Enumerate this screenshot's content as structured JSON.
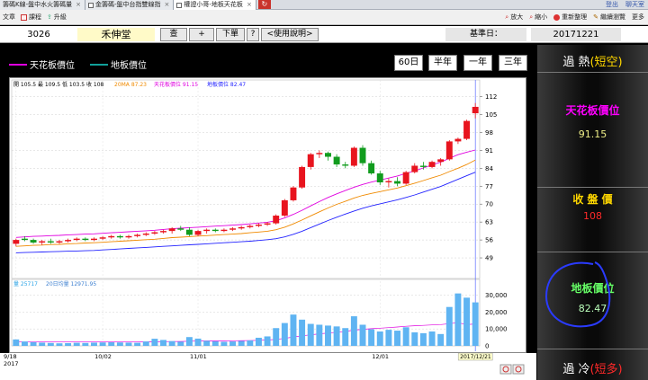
{
  "browser": {
    "tabs": [
      {
        "label": "籌碼K線-盤中水火籌碼量",
        "active": false
      },
      {
        "label": "金籌碼-盤中台指雙線指",
        "active": false
      },
      {
        "label": "權證小哥-地板天花板",
        "active": true
      }
    ],
    "right_links": [
      "登出",
      "聊天室"
    ]
  },
  "toolbar": {
    "left": [
      "文章",
      "課程",
      "升級"
    ],
    "right": [
      "放大",
      "縮小",
      "重新整理",
      "繼續瀏覽",
      "更多"
    ]
  },
  "app": {
    "stock_code": "3026",
    "stock_name": "禾伸堂",
    "buttons": {
      "query": "查",
      "add": "+",
      "next": "下單",
      "help_q": "?",
      "usage": "<使用說明>"
    },
    "base_date_label": "基準日：",
    "base_date": "20171221"
  },
  "legend": {
    "ceiling": "天花板價位",
    "floor": "地板價位"
  },
  "ranges": [
    "60日",
    "半年",
    "一年",
    "三年"
  ],
  "chart_info": {
    "ohlc": "開 105.5 最 109.5 低 103.5 收 108",
    "ma20": "20MA 87.23",
    "ceiling": "天花板價位 91.15",
    "floor": "地板價位 82.47",
    "volume": "量 25717",
    "vol_ma": "20日均量 12971.95",
    "current_date": "2017/12/21"
  },
  "right_panel": {
    "overheat_label": "過 熱",
    "overheat_suffix": "(短空)",
    "ceiling_label": "天花板價位",
    "ceiling_value": "91.15",
    "close_label": "收 盤 價",
    "close_value": "108",
    "floor_label": "地板價位",
    "floor_value": "82.47",
    "overcold_label": "過 冷",
    "overcold_suffix": "(短多)"
  },
  "colors": {
    "up": "#e8141e",
    "down": "#119c1e",
    "ceiling": "#e000e0",
    "floor": "#2222ff",
    "ma": "#f08a00",
    "volume": "#5fb4f2",
    "panel_yellow": "#ffd700",
    "panel_magenta": "#ff00ff",
    "panel_green": "#66ff66",
    "panel_red": "#ff2a2a"
  },
  "chart_data": {
    "type": "candlestick",
    "price_ylim": [
      42,
      115
    ],
    "price_ticks": [
      49,
      56,
      63,
      70,
      77,
      84,
      91,
      98,
      105,
      112
    ],
    "volume_ylim": [
      0,
      34000
    ],
    "volume_ticks": [
      "0",
      "10,000",
      "20,000",
      "30,000"
    ],
    "x_tick_labels": [
      {
        "label": "9/18",
        "index": 0
      },
      {
        "label": "10/02",
        "index": 10
      },
      {
        "label": "11/01",
        "index": 21
      },
      {
        "label": "12/01",
        "index": 42
      }
    ],
    "x_year_label": "2017",
    "candles": [
      {
        "o": 54.5,
        "h": 56.5,
        "l": 53.5,
        "c": 56,
        "v": 3800
      },
      {
        "o": 56.5,
        "h": 57.5,
        "l": 55.5,
        "c": 56,
        "v": 2600
      },
      {
        "o": 56,
        "h": 56.5,
        "l": 54.5,
        "c": 55,
        "v": 2200
      },
      {
        "o": 55,
        "h": 56,
        "l": 54,
        "c": 55.5,
        "v": 1900
      },
      {
        "o": 55.5,
        "h": 56.5,
        "l": 54.5,
        "c": 55,
        "v": 1700
      },
      {
        "o": 55,
        "h": 56,
        "l": 54.5,
        "c": 55.5,
        "v": 1500
      },
      {
        "o": 55.5,
        "h": 56.5,
        "l": 55,
        "c": 56,
        "v": 1600
      },
      {
        "o": 56,
        "h": 57,
        "l": 55.5,
        "c": 56.5,
        "v": 1800
      },
      {
        "o": 56.5,
        "h": 57,
        "l": 55.5,
        "c": 56,
        "v": 1700
      },
      {
        "o": 56,
        "h": 57,
        "l": 55.5,
        "c": 56.5,
        "v": 1900
      },
      {
        "o": 56.5,
        "h": 57.5,
        "l": 56,
        "c": 57,
        "v": 2000
      },
      {
        "o": 57,
        "h": 58,
        "l": 56.5,
        "c": 57.5,
        "v": 2100
      },
      {
        "o": 57.5,
        "h": 58,
        "l": 56.5,
        "c": 57,
        "v": 2000
      },
      {
        "o": 57,
        "h": 58,
        "l": 56.5,
        "c": 57.5,
        "v": 1900
      },
      {
        "o": 57.5,
        "h": 58.5,
        "l": 57,
        "c": 58,
        "v": 1800
      },
      {
        "o": 58,
        "h": 59,
        "l": 57.5,
        "c": 58.5,
        "v": 2600
      },
      {
        "o": 58.5,
        "h": 59.5,
        "l": 58,
        "c": 59,
        "v": 4200
      },
      {
        "o": 59,
        "h": 60,
        "l": 58.5,
        "c": 59.5,
        "v": 3500
      },
      {
        "o": 59.5,
        "h": 61,
        "l": 58.5,
        "c": 60.5,
        "v": 2800
      },
      {
        "o": 60.5,
        "h": 61.5,
        "l": 59.5,
        "c": 60,
        "v": 2500
      },
      {
        "o": 60,
        "h": 61,
        "l": 57.5,
        "c": 58,
        "v": 5200
      },
      {
        "o": 58,
        "h": 60,
        "l": 57.5,
        "c": 59.5,
        "v": 4300
      },
      {
        "o": 59.5,
        "h": 60.5,
        "l": 58.5,
        "c": 60,
        "v": 3000
      },
      {
        "o": 60,
        "h": 60.5,
        "l": 59,
        "c": 59.5,
        "v": 2700
      },
      {
        "o": 59.5,
        "h": 60.5,
        "l": 59,
        "c": 60,
        "v": 2400
      },
      {
        "o": 60,
        "h": 61,
        "l": 59.5,
        "c": 60.5,
        "v": 2600
      },
      {
        "o": 60.5,
        "h": 61.5,
        "l": 60,
        "c": 61,
        "v": 2900
      },
      {
        "o": 61,
        "h": 62,
        "l": 60.5,
        "c": 61.5,
        "v": 3200
      },
      {
        "o": 61.5,
        "h": 62.5,
        "l": 61,
        "c": 62,
        "v": 4800
      },
      {
        "o": 62,
        "h": 63,
        "l": 61.5,
        "c": 62.5,
        "v": 5600
      },
      {
        "o": 62.5,
        "h": 66,
        "l": 62,
        "c": 65.5,
        "v": 10500
      },
      {
        "o": 65.5,
        "h": 72,
        "l": 65,
        "c": 71.5,
        "v": 13500
      },
      {
        "o": 71.5,
        "h": 77,
        "l": 71,
        "c": 76.5,
        "v": 18500
      },
      {
        "o": 76.5,
        "h": 85,
        "l": 76,
        "c": 84.5,
        "v": 15500
      },
      {
        "o": 84.5,
        "h": 90,
        "l": 83.5,
        "c": 89.5,
        "v": 13000
      },
      {
        "o": 89.5,
        "h": 91,
        "l": 88,
        "c": 90,
        "v": 12500
      },
      {
        "o": 90,
        "h": 90.5,
        "l": 87,
        "c": 88.5,
        "v": 12000
      },
      {
        "o": 88.5,
        "h": 89.5,
        "l": 84.5,
        "c": 85.5,
        "v": 11500
      },
      {
        "o": 85.5,
        "h": 86.5,
        "l": 84,
        "c": 85,
        "v": 10500
      },
      {
        "o": 85,
        "h": 92.5,
        "l": 84.5,
        "c": 92,
        "v": 17500
      },
      {
        "o": 92,
        "h": 93,
        "l": 85,
        "c": 86,
        "v": 12500
      },
      {
        "o": 86,
        "h": 87,
        "l": 81.5,
        "c": 82,
        "v": 9800
      },
      {
        "o": 82,
        "h": 83,
        "l": 77.5,
        "c": 78.5,
        "v": 8500
      },
      {
        "o": 78.5,
        "h": 80,
        "l": 76.5,
        "c": 79,
        "v": 9500
      },
      {
        "o": 79,
        "h": 80.5,
        "l": 77,
        "c": 78,
        "v": 9000
      },
      {
        "o": 78,
        "h": 83,
        "l": 77.5,
        "c": 82.5,
        "v": 11000
      },
      {
        "o": 82.5,
        "h": 86,
        "l": 82,
        "c": 85,
        "v": 8000
      },
      {
        "o": 85,
        "h": 86.5,
        "l": 83.5,
        "c": 84.5,
        "v": 7500
      },
      {
        "o": 84.5,
        "h": 87,
        "l": 84,
        "c": 86.5,
        "v": 8500
      },
      {
        "o": 86.5,
        "h": 88,
        "l": 85,
        "c": 87.5,
        "v": 7000
      },
      {
        "o": 87.5,
        "h": 95,
        "l": 87,
        "c": 94.5,
        "v": 23000
      },
      {
        "o": 94.5,
        "h": 96,
        "l": 93.5,
        "c": 95.5,
        "v": 31000
      },
      {
        "o": 95.5,
        "h": 103,
        "l": 95,
        "c": 102.5,
        "v": 28500
      },
      {
        "o": 105.5,
        "h": 109.5,
        "l": 103.5,
        "c": 108,
        "v": 25717
      }
    ],
    "ma20": [
      53.5,
      53.7,
      53.9,
      54.0,
      54.2,
      54.3,
      54.5,
      54.6,
      54.8,
      54.9,
      55.1,
      55.3,
      55.5,
      55.7,
      55.9,
      56.1,
      56.3,
      56.6,
      56.9,
      57.1,
      57.3,
      57.5,
      57.7,
      57.9,
      58.1,
      58.3,
      58.5,
      58.8,
      59.1,
      59.4,
      60.0,
      61.0,
      62.3,
      63.8,
      65.4,
      67.0,
      68.5,
      69.9,
      71.1,
      72.4,
      73.4,
      74.2,
      74.9,
      75.6,
      76.3,
      77.2,
      78.2,
      79.2,
      80.3,
      81.3,
      82.7,
      84.0,
      85.5,
      87.23
    ],
    "ceiling": [
      57.0,
      57.2,
      57.4,
      57.5,
      57.7,
      57.8,
      58.0,
      58.1,
      58.3,
      58.4,
      58.6,
      58.8,
      59.0,
      59.2,
      59.4,
      59.6,
      59.8,
      60.1,
      60.4,
      60.6,
      60.8,
      61.0,
      61.2,
      61.4,
      61.6,
      61.8,
      62.0,
      62.3,
      62.6,
      62.9,
      63.5,
      64.6,
      66.0,
      67.6,
      69.3,
      71.0,
      72.6,
      74.0,
      75.3,
      76.6,
      77.7,
      78.6,
      79.4,
      80.2,
      81.0,
      82.0,
      83.0,
      84.1,
      85.3,
      86.4,
      87.9,
      89.3,
      90.3,
      91.15
    ],
    "floor": [
      51.0,
      51.1,
      51.2,
      51.3,
      51.4,
      51.5,
      51.6,
      51.7,
      51.8,
      51.9,
      52.1,
      52.3,
      52.5,
      52.7,
      52.9,
      53.1,
      53.3,
      53.5,
      53.7,
      53.9,
      54.1,
      54.3,
      54.5,
      54.7,
      54.9,
      55.1,
      55.3,
      55.5,
      55.8,
      56.1,
      56.5,
      57.2,
      58.2,
      59.4,
      60.8,
      62.2,
      63.6,
      64.9,
      66.1,
      67.3,
      68.4,
      69.3,
      70.1,
      70.9,
      71.7,
      72.6,
      73.6,
      74.7,
      75.8,
      76.9,
      78.3,
      79.7,
      81.1,
      82.47
    ],
    "vol_ma": [
      2300,
      2300,
      2300,
      2300,
      2300,
      2300,
      2300,
      2300,
      2300,
      2300,
      2300,
      2300,
      2300,
      2300,
      2300,
      2350,
      2450,
      2500,
      2550,
      2600,
      2750,
      2850,
      2900,
      2950,
      3000,
      3050,
      3100,
      3150,
      3300,
      3450,
      3850,
      4400,
      5250,
      5950,
      6550,
      7100,
      7600,
      8100,
      8550,
      9300,
      9800,
      10150,
      10450,
      10800,
      11150,
      11600,
      11900,
      12100,
      12400,
      12600,
      13100,
      13700,
      12600,
      12971.95
    ]
  }
}
